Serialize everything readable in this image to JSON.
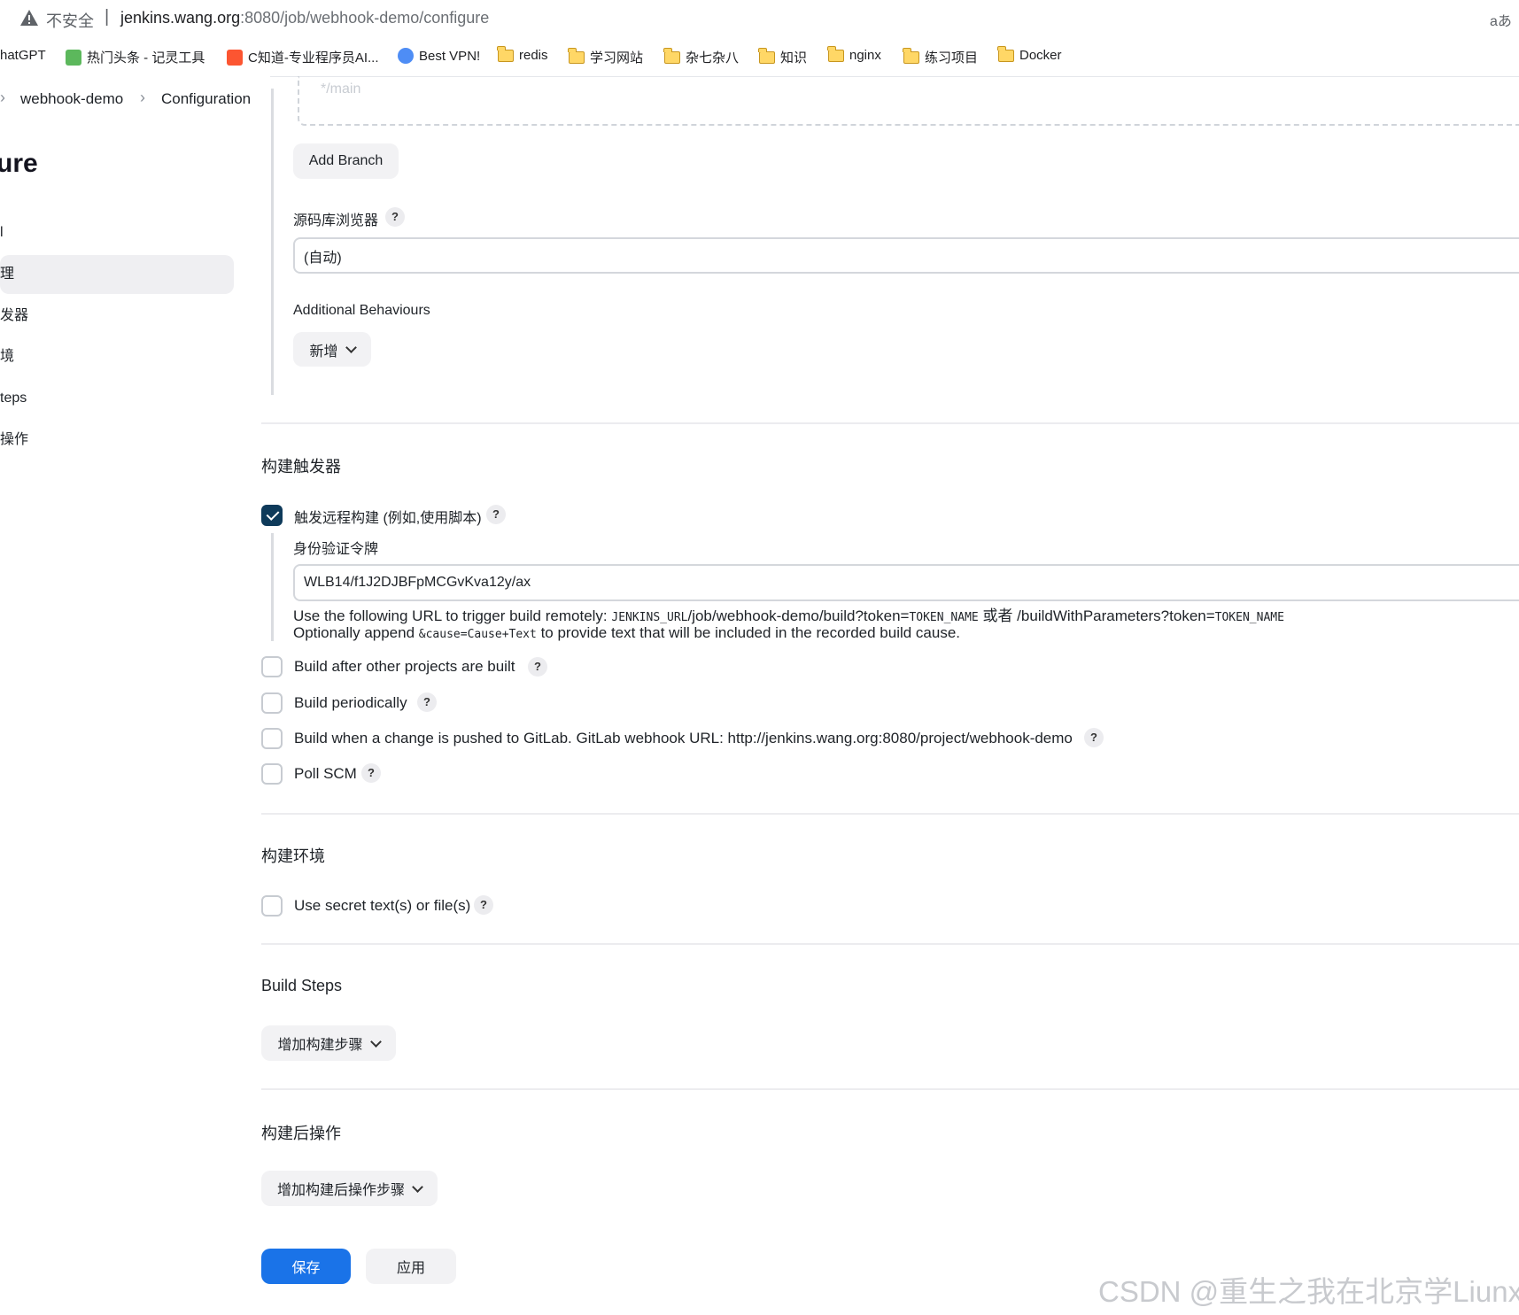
{
  "browser": {
    "insecure_label": "不安全",
    "separator": "|",
    "url_host": "jenkins.wang.org",
    "url_path": ":8080/job/webhook-demo/configure",
    "translate_label": "aあ"
  },
  "bookmarks": [
    {
      "label": "hatGPT",
      "icon": "none"
    },
    {
      "label": "热门头条 - 记灵工具",
      "icon": "app-icon"
    },
    {
      "label": "C知道-专业程序员AI...",
      "icon": "csdn-icon"
    },
    {
      "label": "Best VPN!",
      "icon": "vpn-icon"
    },
    {
      "label": "redis",
      "icon": "folder-icon"
    },
    {
      "label": "学习网站",
      "icon": "folder-icon"
    },
    {
      "label": "杂七杂八",
      "icon": "folder-icon"
    },
    {
      "label": "知识",
      "icon": "folder-icon"
    },
    {
      "label": "nginx",
      "icon": "folder-icon"
    },
    {
      "label": "练习项目",
      "icon": "folder-icon"
    },
    {
      "label": "Docker",
      "icon": "folder-icon"
    }
  ],
  "breadcrumb": {
    "job": "webhook-demo",
    "page": "Configuration"
  },
  "sidebar": {
    "title": "ure",
    "items": [
      {
        "label": "l",
        "active": false
      },
      {
        "label": "理",
        "active": true
      },
      {
        "label": "发器",
        "active": false
      },
      {
        "label": "境",
        "active": false
      },
      {
        "label": "teps",
        "active": false
      },
      {
        "label": "操作",
        "active": false
      }
    ]
  },
  "scm": {
    "branch_ghost": "*/main",
    "add_branch_label": "Add Branch",
    "repo_browser_label": "源码库浏览器",
    "repo_browser_value": "(自动)",
    "additional_behaviours_label": "Additional Behaviours",
    "add_label": "新增"
  },
  "triggers": {
    "section_title": "构建触发器",
    "remote": {
      "label": "触发远程构建 (例如,使用脚本)",
      "checked": true,
      "token_label": "身份验证令牌",
      "token_value": "WLB14/f1J2DJBFpMCGvKva12y/ax",
      "help_line1_prefix": "Use the following URL to trigger build remotely: ",
      "help_line1_code1": "JENKINS_URL",
      "help_line1_mid": "/job/webhook-demo/build?token=",
      "help_line1_code2": "TOKEN_NAME",
      "help_line1_or": " 或者 /buildWithParameters?token=",
      "help_line1_code3": "TOKEN_NAME",
      "help_line2_prefix": "Optionally append ",
      "help_line2_code": "&cause=Cause+Text",
      "help_line2_suffix": " to provide text that will be included in the recorded build cause."
    },
    "options": [
      {
        "label": "Build after other projects are built",
        "checked": false
      },
      {
        "label": "Build periodically",
        "checked": false
      },
      {
        "label": "Build when a change is pushed to GitLab. GitLab webhook URL: http://jenkins.wang.org:8080/project/webhook-demo",
        "checked": false
      },
      {
        "label": "Poll SCM",
        "checked": false
      }
    ]
  },
  "environment": {
    "section_title": "构建环境",
    "secret_label": "Use secret text(s) or file(s)"
  },
  "build_steps": {
    "section_title": "Build Steps",
    "add_label": "增加构建步骤"
  },
  "post_build": {
    "section_title": "构建后操作",
    "add_label": "增加构建后操作步骤"
  },
  "actions": {
    "save_label": "保存",
    "apply_label": "应用"
  },
  "help_glyph": "?",
  "watermark": "CSDN @重生之我在北京学Liunx",
  "colors": {
    "primary": "#1a73e8",
    "checkbox_checked": "#0e3a5a"
  }
}
